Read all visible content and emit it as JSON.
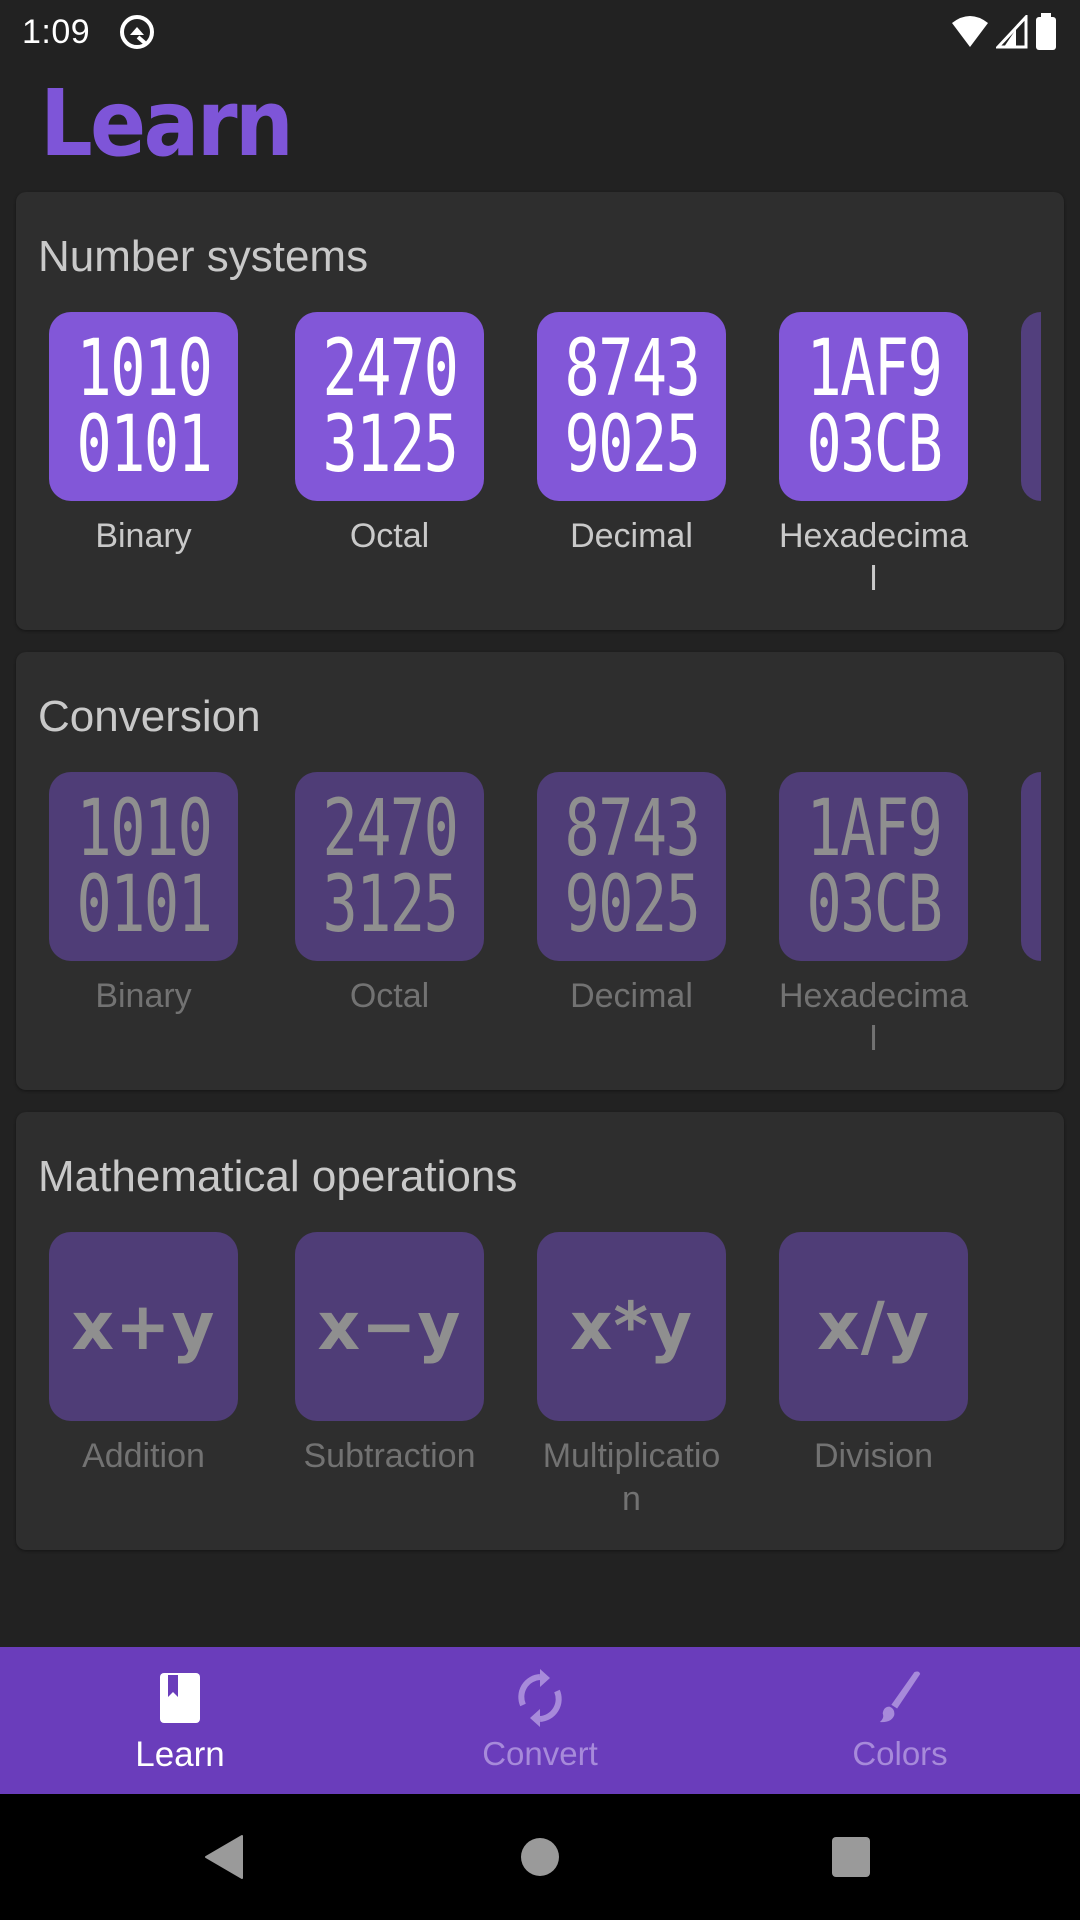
{
  "status_bar": {
    "time": "1:09",
    "icons": [
      "q-notification-icon",
      "wifi-icon",
      "cell-signal-icon",
      "battery-icon"
    ]
  },
  "page": {
    "title": "Learn"
  },
  "sections": [
    {
      "title": "Number systems",
      "enabled": true,
      "tiles": [
        {
          "line1": "1010",
          "line2": "0101",
          "label": "Binary"
        },
        {
          "line1": "2470",
          "line2": "3125",
          "label": "Octal"
        },
        {
          "line1": "8743",
          "line2": "9025",
          "label": "Decimal"
        },
        {
          "line1": "1AF9",
          "line2": "03CB",
          "label": "Hexadecimal"
        }
      ]
    },
    {
      "title": "Conversion",
      "enabled": false,
      "tiles": [
        {
          "line1": "1010",
          "line2": "0101",
          "label": "Binary"
        },
        {
          "line1": "2470",
          "line2": "3125",
          "label": "Octal"
        },
        {
          "line1": "8743",
          "line2": "9025",
          "label": "Decimal"
        },
        {
          "line1": "1AF9",
          "line2": "03CB",
          "label": "Hexadecimal"
        }
      ]
    },
    {
      "title": "Mathematical operations",
      "enabled": false,
      "tiles": [
        {
          "symbol": "x+y",
          "label": "Addition"
        },
        {
          "symbol": "x−y",
          "label": "Subtraction"
        },
        {
          "symbol": "x*y",
          "label": "Multiplication"
        },
        {
          "symbol": "x/y",
          "label": "Division"
        }
      ]
    }
  ],
  "bottom_nav": {
    "items": [
      {
        "label": "Learn",
        "icon": "book-icon",
        "active": true
      },
      {
        "label": "Convert",
        "icon": "sync-icon",
        "active": false
      },
      {
        "label": "Colors",
        "icon": "brush-icon",
        "active": false
      }
    ]
  },
  "colors": {
    "accent": "#7e55d8",
    "tile_active": "#8257d8",
    "tile_disabled": "#4f3d77",
    "nav_bar": "#6a3dbb",
    "background": "#222222",
    "card": "#2e2e2e"
  }
}
